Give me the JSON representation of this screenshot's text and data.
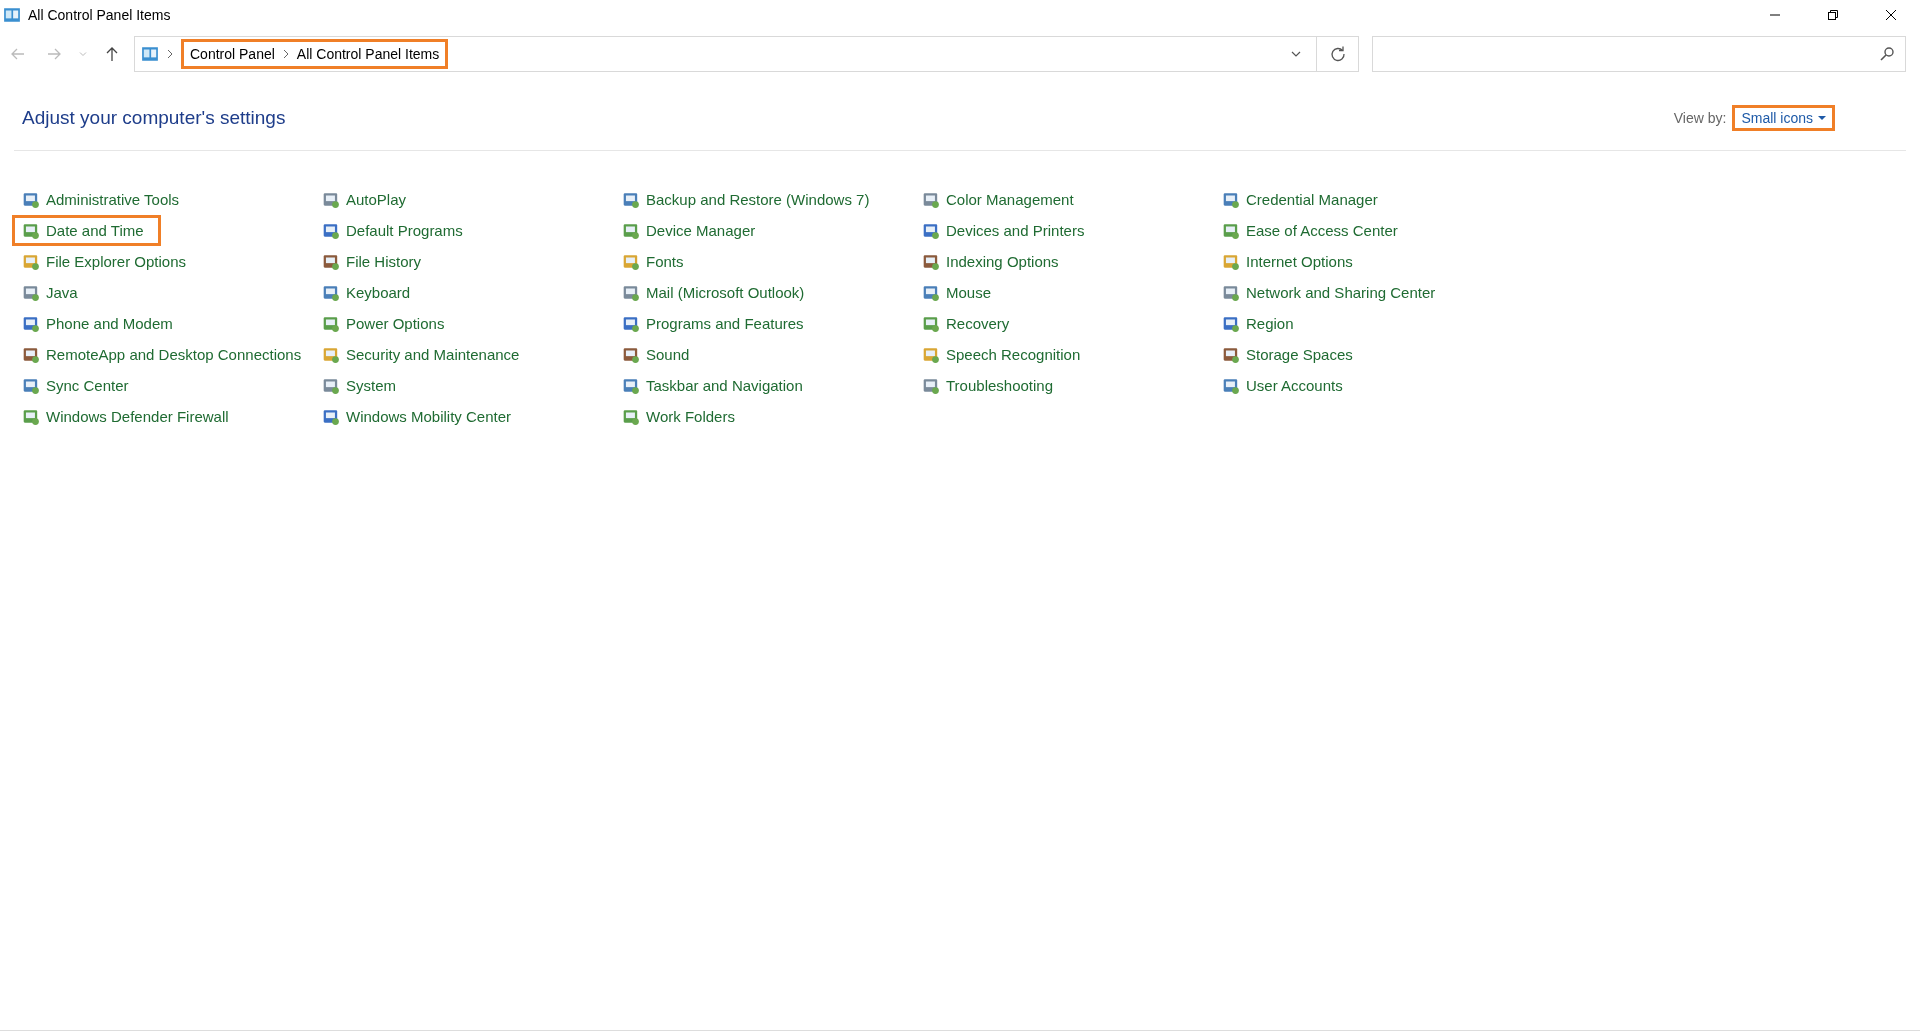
{
  "window": {
    "title": "All Control Panel Items"
  },
  "address_bar": {
    "breadcrumbs": [
      "Control Panel",
      "All Control Panel Items"
    ],
    "highlighted": true
  },
  "heading": "Adjust your computer's settings",
  "view_by": {
    "label": "View by:",
    "value": "Small icons",
    "highlighted": true
  },
  "columns": [
    {
      "items": [
        {
          "label": "Administrative Tools",
          "highlighted": false
        },
        {
          "label": "Date and Time",
          "highlighted": true
        },
        {
          "label": "File Explorer Options",
          "highlighted": false
        },
        {
          "label": "Java",
          "highlighted": false
        },
        {
          "label": "Phone and Modem",
          "highlighted": false
        },
        {
          "label": "RemoteApp and Desktop Connections",
          "highlighted": false
        },
        {
          "label": "Sync Center",
          "highlighted": false
        },
        {
          "label": "Windows Defender Firewall",
          "highlighted": false
        }
      ]
    },
    {
      "items": [
        {
          "label": "AutoPlay",
          "highlighted": false
        },
        {
          "label": "Default Programs",
          "highlighted": false
        },
        {
          "label": "File History",
          "highlighted": false
        },
        {
          "label": "Keyboard",
          "highlighted": false
        },
        {
          "label": "Power Options",
          "highlighted": false
        },
        {
          "label": "Security and Maintenance",
          "highlighted": false
        },
        {
          "label": "System",
          "highlighted": false
        },
        {
          "label": "Windows Mobility Center",
          "highlighted": false
        }
      ]
    },
    {
      "items": [
        {
          "label": "Backup and Restore (Windows 7)",
          "highlighted": false
        },
        {
          "label": "Device Manager",
          "highlighted": false
        },
        {
          "label": "Fonts",
          "highlighted": false
        },
        {
          "label": "Mail (Microsoft Outlook)",
          "highlighted": false
        },
        {
          "label": "Programs and Features",
          "highlighted": false
        },
        {
          "label": "Sound",
          "highlighted": false
        },
        {
          "label": "Taskbar and Navigation",
          "highlighted": false
        },
        {
          "label": "Work Folders",
          "highlighted": false
        }
      ]
    },
    {
      "items": [
        {
          "label": "Color Management",
          "highlighted": false
        },
        {
          "label": "Devices and Printers",
          "highlighted": false
        },
        {
          "label": "Indexing Options",
          "highlighted": false
        },
        {
          "label": "Mouse",
          "highlighted": false
        },
        {
          "label": "Recovery",
          "highlighted": false
        },
        {
          "label": "Speech Recognition",
          "highlighted": false
        },
        {
          "label": "Troubleshooting",
          "highlighted": false
        }
      ]
    },
    {
      "items": [
        {
          "label": "Credential Manager",
          "highlighted": false
        },
        {
          "label": "Ease of Access Center",
          "highlighted": false
        },
        {
          "label": "Internet Options",
          "highlighted": false
        },
        {
          "label": "Network and Sharing Center",
          "highlighted": false
        },
        {
          "label": "Region",
          "highlighted": false
        },
        {
          "label": "Storage Spaces",
          "highlighted": false
        },
        {
          "label": "User Accounts",
          "highlighted": false
        }
      ]
    }
  ]
}
